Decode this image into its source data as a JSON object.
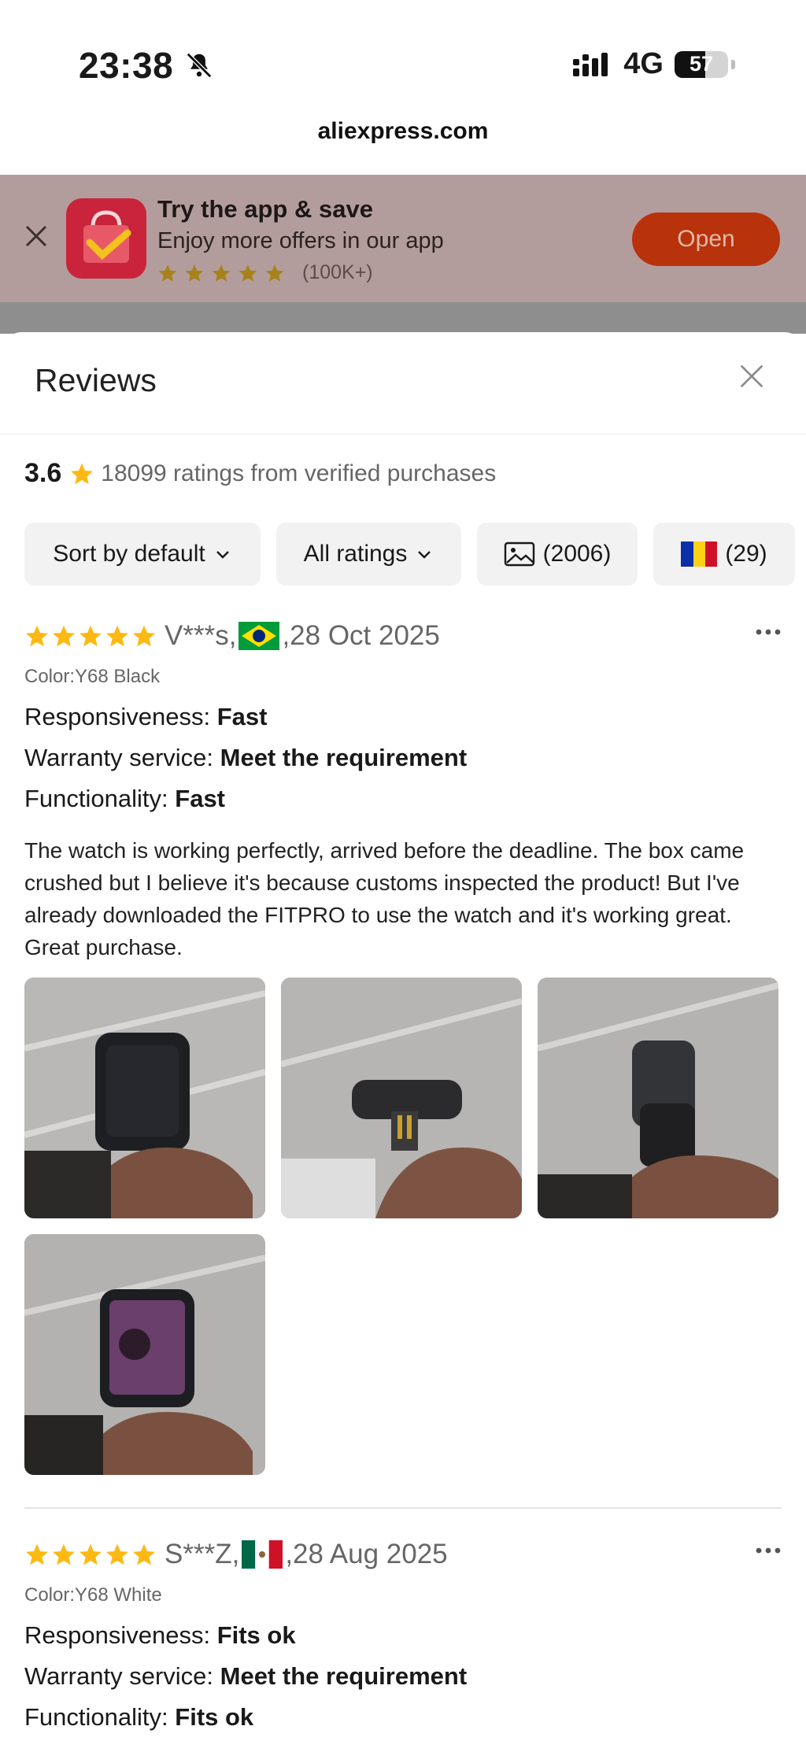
{
  "status_bar": {
    "time": "23:38",
    "network": "4G",
    "battery": "57",
    "battery_level_percent": 57
  },
  "browser": {
    "url": "aliexpress.com"
  },
  "app_banner": {
    "title": "Try the app & save",
    "subtitle": "Enjoy more offers in our app",
    "rating_count": "(100K+)",
    "open_label": "Open",
    "colors": {
      "open_button": "#b8320c",
      "logo": "#c9243b"
    }
  },
  "reviews_sheet": {
    "title": "Reviews",
    "average_rating": "3.6",
    "summary_text": "18099 ratings from verified purchases",
    "filters": {
      "sort": "Sort by default",
      "ratings": "All ratings",
      "photos_count": "(2006)",
      "country_count": "(29)"
    },
    "reviews": [
      {
        "stars": 5,
        "reviewer": "V***s,",
        "country_flag": "brazil-flag",
        "date": ",28 Oct 2025",
        "color": "Color:Y68 Black",
        "attributes": [
          {
            "label": "Responsiveness: ",
            "value": "Fast"
          },
          {
            "label": "Warranty service: ",
            "value": "Meet the requirement"
          },
          {
            "label": "Functionality: ",
            "value": "Fast"
          }
        ],
        "text": "The watch is working perfectly, arrived before the deadline. The box came crushed but I believe it's because customs inspected the product! But I've already downloaded the FITPRO to use the watch and it's working great. Great purchase.",
        "photo_count": 4
      },
      {
        "stars": 5,
        "reviewer": "S***Z,",
        "country_flag": "mexico-flag",
        "date": ",28 Aug 2025",
        "color": "Color:Y68 White",
        "attributes": [
          {
            "label": "Responsiveness: ",
            "value": "Fits ok"
          },
          {
            "label": "Warranty service: ",
            "value": "Meet the requirement"
          },
          {
            "label": "Functionality: ",
            "value": "Fits ok"
          }
        ]
      }
    ],
    "colors": {
      "star": "#fdb913",
      "chip_bg": "#f2f2f2"
    }
  }
}
